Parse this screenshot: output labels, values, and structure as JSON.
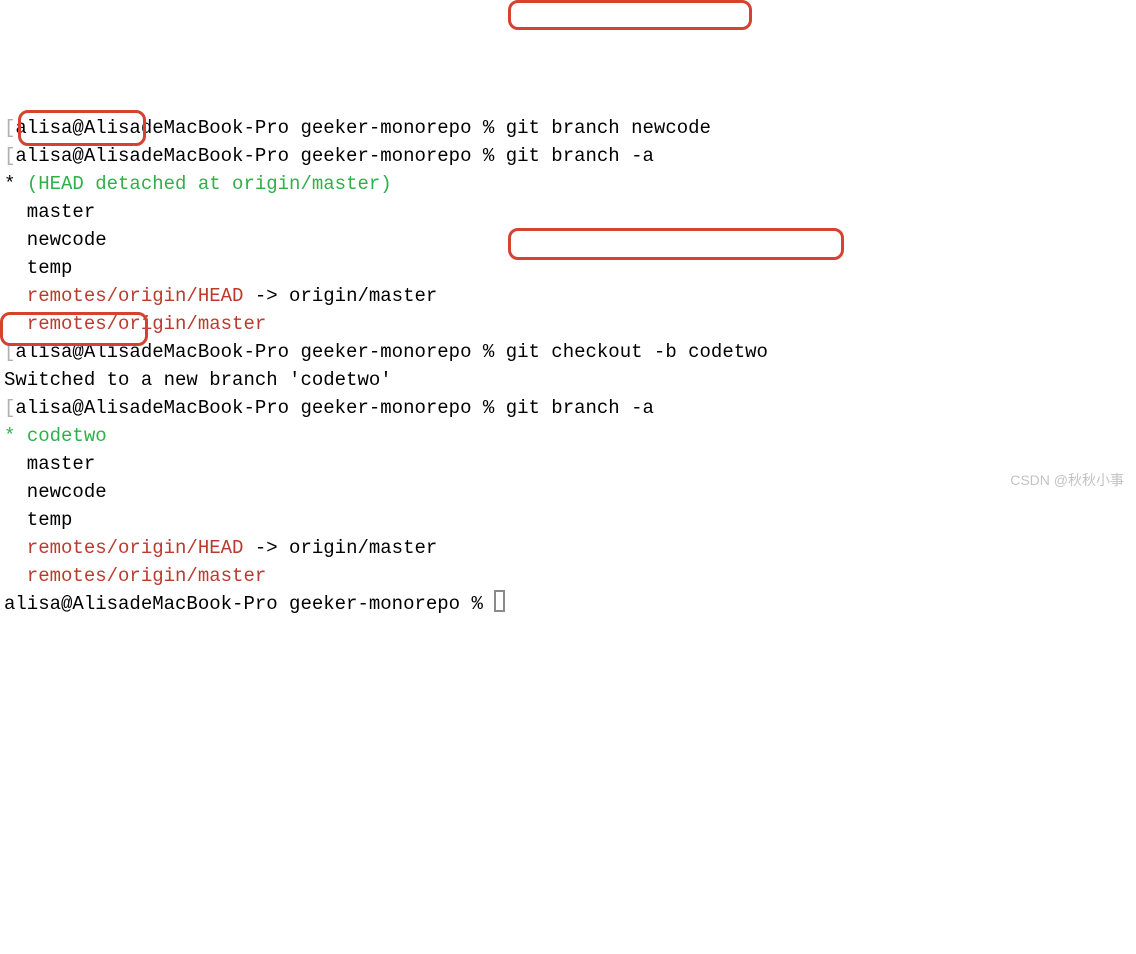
{
  "colors": {
    "green": "#2fb04a",
    "remote": "#ba3b2e",
    "highlight": "#d64130"
  },
  "lines": {
    "l1_prompt": "alisa@AlisadeMacBook-Pro geeker-monorepo % ",
    "l1_cmd": "git branch newcode",
    "l2_prompt": "alisa@AlisadeMacBook-Pro geeker-monorepo % ",
    "l2_cmd": "git branch -a",
    "l3_star": "* ",
    "l3_head": "(HEAD detached at origin/master)",
    "l4": "  master",
    "l5": "  newcode",
    "l6": "  temp",
    "l7a": "  remotes/origin/HEAD",
    "l7b": " -> origin/master",
    "l8": "  remotes/origin/master",
    "l9_prompt": "alisa@AlisadeMacBook-Pro geeker-monorepo % ",
    "l9_cmd": "git checkout -b codetwo",
    "l10": "Switched to a new branch 'codetwo'",
    "l11_prompt": "alisa@AlisadeMacBook-Pro geeker-monorepo % ",
    "l11_cmd": "git branch -a",
    "l12_star": "* ",
    "l12_branch": "codetwo",
    "l13": "  master",
    "l14": "  newcode",
    "l15": "  temp",
    "l16a": "  remotes/origin/HEAD",
    "l16b": " -> origin/master",
    "l17": "  remotes/origin/master",
    "l18_prompt": "alisa@AlisadeMacBook-Pro geeker-monorepo % "
  },
  "watermark": "CSDN @秋秋小事",
  "bracket": "[",
  "bracket_r": "]"
}
